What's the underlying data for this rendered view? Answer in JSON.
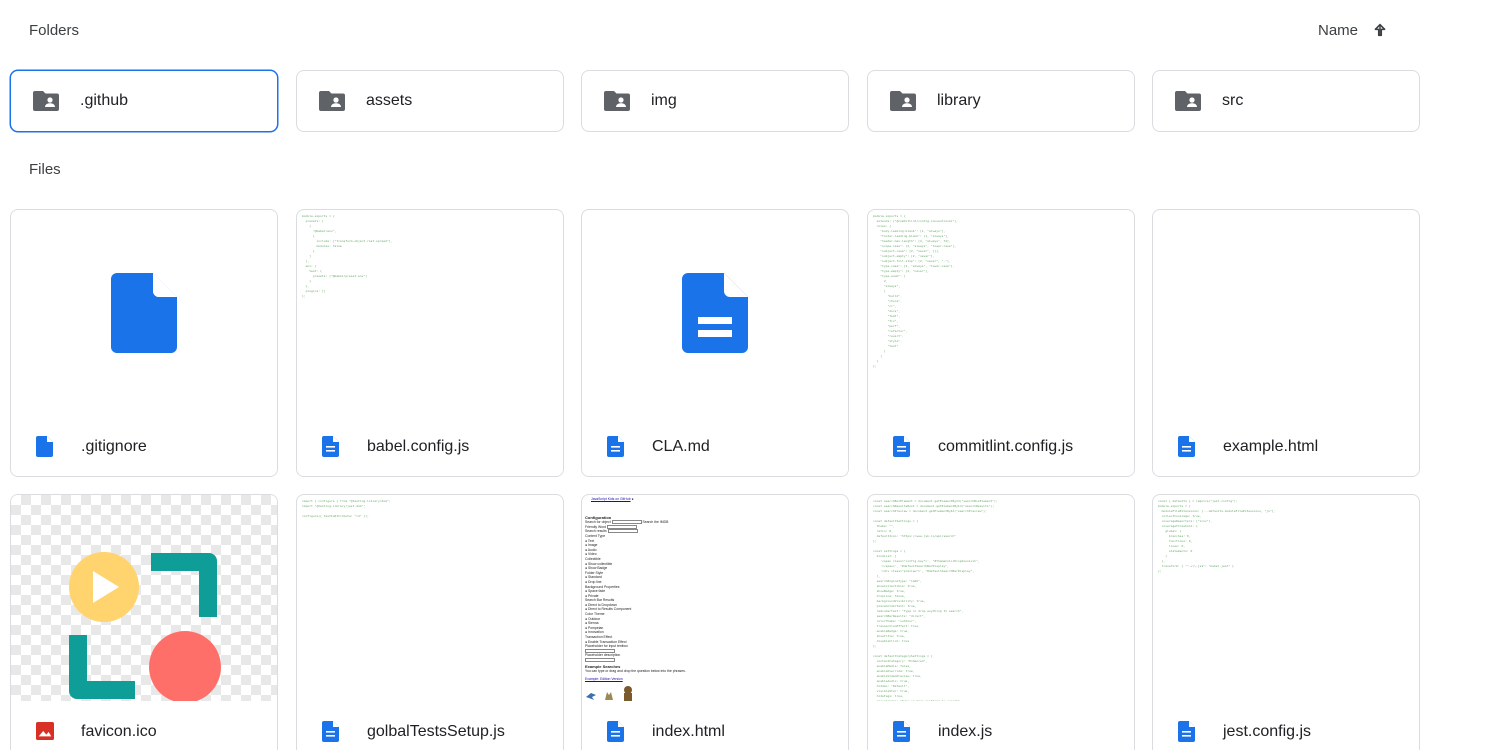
{
  "header": {
    "folders_title": "Folders",
    "files_title": "Files",
    "sort_label": "Name",
    "sort_direction_icon": "arrow-up-icon"
  },
  "folders": [
    {
      "label": ".github",
      "icon": "folder-shared-icon",
      "selected": true
    },
    {
      "label": "assets",
      "icon": "folder-shared-icon"
    },
    {
      "label": "img",
      "icon": "folder-shared-icon"
    },
    {
      "label": "library",
      "icon": "folder-shared-icon"
    },
    {
      "label": "src",
      "icon": "folder-shared-icon"
    }
  ],
  "files": [
    {
      "label": ".gitignore",
      "icon": "file-icon"
    },
    {
      "label": "babel.config.js",
      "icon": "doc-icon"
    },
    {
      "label": "CLA.md",
      "icon": "doc-icon"
    },
    {
      "label": "commitlint.config.js",
      "icon": "doc-icon"
    },
    {
      "label": "example.html",
      "icon": "doc-icon"
    },
    {
      "label": "favicon.ico",
      "icon": "image-icon"
    },
    {
      "label": "golbalTestsSetup.js",
      "icon": "doc-icon"
    },
    {
      "label": "index.html",
      "icon": "doc-icon"
    },
    {
      "label": "index.js",
      "icon": "doc-icon"
    },
    {
      "label": "jest.config.js",
      "icon": "doc-icon"
    }
  ],
  "colors": {
    "accent": "#1a73e8",
    "folder_icon": "#5f6368",
    "image_icon": "#d93025"
  }
}
